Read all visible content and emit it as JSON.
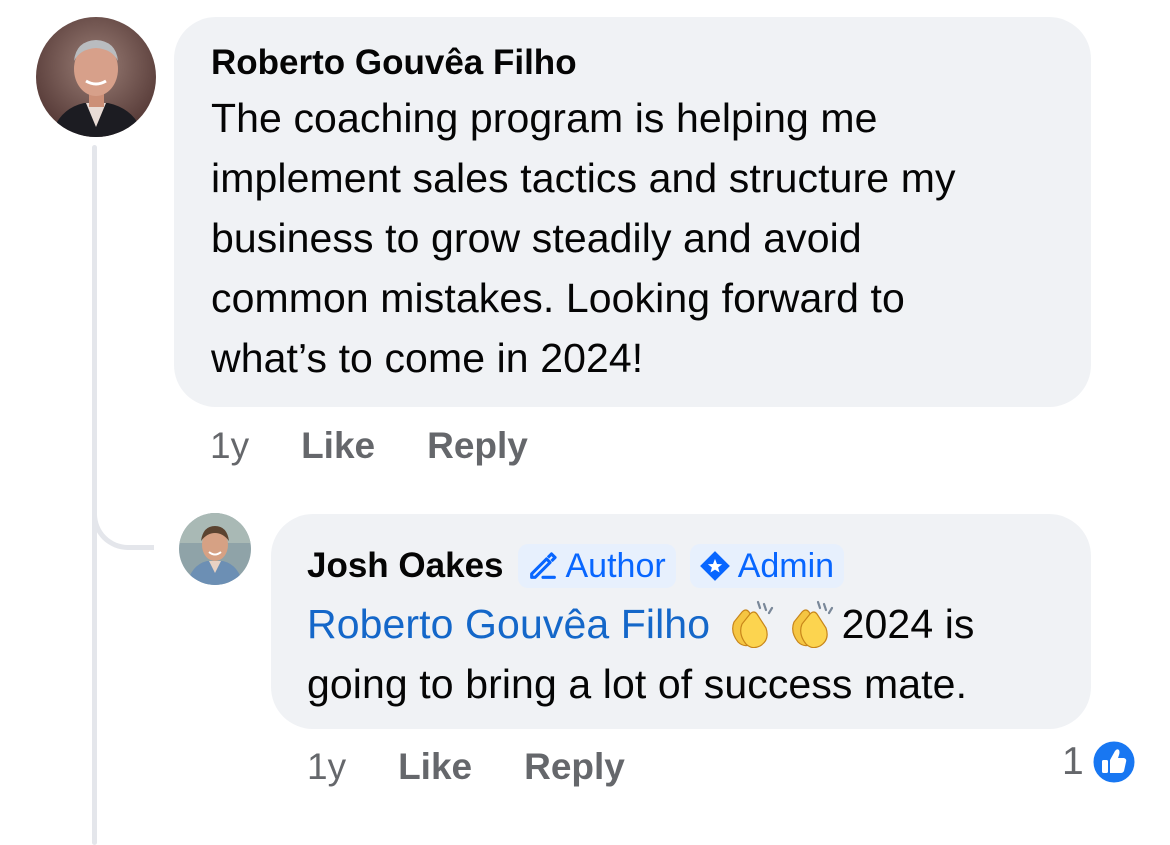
{
  "comment": {
    "author": "Roberto Gouvêa Filho",
    "text_lines": [
      "The coaching program is helping me",
      "implement sales tactics and structure my",
      "business to grow steadily and avoid",
      "common mistakes.  Looking forward to",
      "what’s to come in 2024!"
    ],
    "age": "1y",
    "like_label": "Like",
    "reply_label": "Reply"
  },
  "reply": {
    "author": "Josh Oakes",
    "badges": {
      "author": "Author",
      "admin": "Admin"
    },
    "mention": "Roberto Gouvêa Filho",
    "text_after_emoji": "2024 is",
    "text_line2": "going to bring a lot of success mate.",
    "emoji": [
      "clapping-hands",
      "clapping-hands"
    ],
    "age": "1y",
    "like_label": "Like",
    "reply_label": "Reply",
    "reaction_count": "1",
    "reaction_type": "like"
  },
  "colors": {
    "bubble": "#f0f2f5",
    "link": "#1467c9",
    "accent": "#0866ff",
    "muted": "#65676b"
  }
}
